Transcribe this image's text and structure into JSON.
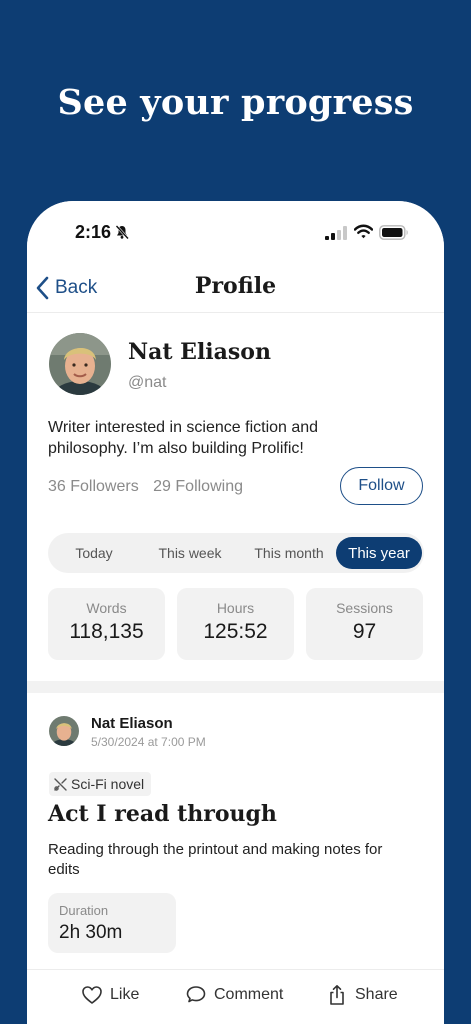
{
  "headline": "See your progress",
  "status_bar": {
    "time": "2:16"
  },
  "nav": {
    "back_label": "Back",
    "title": "Profile"
  },
  "profile": {
    "name": "Nat Eliason",
    "handle": "@nat",
    "bio": "Writer interested in science fiction and philosophy. I’m also building Prolific!",
    "followers": "36 Followers",
    "following": "29 Following",
    "follow_label": "Follow"
  },
  "period_tabs": [
    {
      "label": "Today",
      "active": false
    },
    {
      "label": "This week",
      "active": false
    },
    {
      "label": "This month",
      "active": false
    },
    {
      "label": "This year",
      "active": true
    }
  ],
  "stats": [
    {
      "label": "Words",
      "value": "118,135"
    },
    {
      "label": "Hours",
      "value": "125:52"
    },
    {
      "label": "Sessions",
      "value": "97"
    }
  ],
  "post": {
    "author": "Nat Eliason",
    "date": "5/30/2024 at 7:00 PM",
    "tag": "Sci-Fi novel",
    "title": "Act I read through",
    "description": "Reading through the printout and making notes for edits",
    "duration_label": "Duration",
    "duration_value": "2h 30m",
    "actions": {
      "like": "Like",
      "comment": "Comment",
      "share": "Share"
    }
  },
  "colors": {
    "brand_navy": "#0d3d73",
    "link_blue": "#1e4f88",
    "surface_gray": "#f2f2f2"
  }
}
